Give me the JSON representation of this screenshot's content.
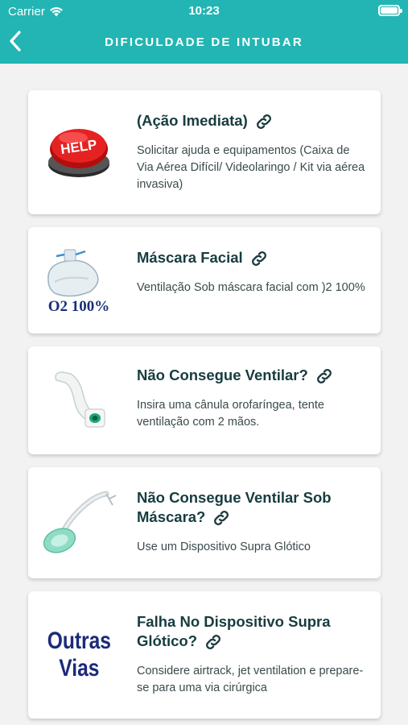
{
  "status_bar": {
    "carrier": "Carrier",
    "time": "10:23"
  },
  "header": {
    "title": "DIFICULDADE DE INTUBAR"
  },
  "cards": [
    {
      "title": "(Ação Imediata)",
      "description": "Solicitar ajuda e equipamentos (Caixa de Via Aérea Difícil/ Videolaringo / Kit via aérea invasiva)",
      "image_label": "HELP"
    },
    {
      "title": "Máscara Facial",
      "description": "Ventilação Sob máscara facial com )2 100%",
      "image_label": "O2 100%"
    },
    {
      "title": "Não Consegue Ventilar?",
      "description": "Insira uma cânula orofaríngea, tente ventilação com 2 mãos."
    },
    {
      "title": "Não Consegue Ventilar Sob Máscara?",
      "description": "Use um Dispositivo Supra Glótico"
    },
    {
      "title": "Falha No Dispositivo Supra Glótico?",
      "description": "Considere airtrack, jet ventilation e prepare-se para uma via cirúrgica",
      "image_label_line1": "Outras",
      "image_label_line2": "Vias"
    }
  ],
  "colors": {
    "header": "#22b5b3",
    "title_text": "#173c3f",
    "link_icon": "#1e3c40"
  },
  "icons": {
    "back": "chevron-left-icon",
    "link": "link-icon",
    "wifi": "wifi-icon",
    "battery": "battery-icon"
  }
}
